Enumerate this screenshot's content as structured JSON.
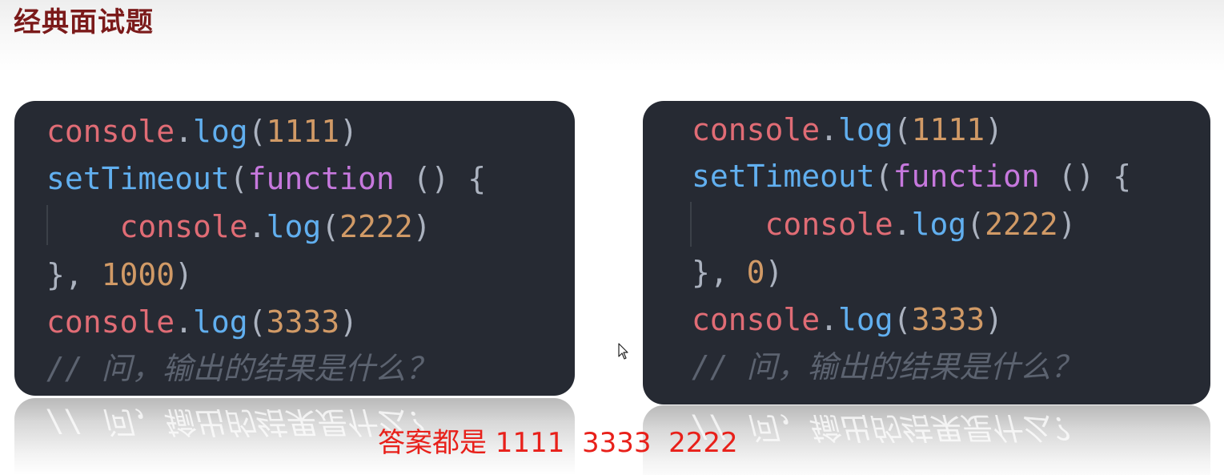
{
  "slide": {
    "title": "经典面试题"
  },
  "left_card": {
    "lines": [
      [
        {
          "t": "console",
          "k": "obj"
        },
        {
          "t": ".",
          "k": "punc"
        },
        {
          "t": "log",
          "k": "fn"
        },
        {
          "t": "(",
          "k": "punc"
        },
        {
          "t": "1111",
          "k": "num"
        },
        {
          "t": ")",
          "k": "punc"
        }
      ],
      [
        {
          "t": "setTimeout",
          "k": "fn"
        },
        {
          "t": "(",
          "k": "punc"
        },
        {
          "t": "function",
          "k": "kw"
        },
        {
          "t": " () {",
          "k": "punc"
        }
      ],
      [
        {
          "t": "    ",
          "k": "punc"
        },
        {
          "t": "console",
          "k": "obj"
        },
        {
          "t": ".",
          "k": "punc"
        },
        {
          "t": "log",
          "k": "fn"
        },
        {
          "t": "(",
          "k": "punc"
        },
        {
          "t": "2222",
          "k": "num"
        },
        {
          "t": ")",
          "k": "punc"
        }
      ],
      [
        {
          "t": "}, ",
          "k": "punc"
        },
        {
          "t": "1000",
          "k": "num"
        },
        {
          "t": ")",
          "k": "punc"
        }
      ],
      [
        {
          "t": "console",
          "k": "obj"
        },
        {
          "t": ".",
          "k": "punc"
        },
        {
          "t": "log",
          "k": "fn"
        },
        {
          "t": "(",
          "k": "punc"
        },
        {
          "t": "3333",
          "k": "num"
        },
        {
          "t": ")",
          "k": "punc"
        }
      ],
      [
        {
          "t": "// 问，输出的结果是什么？",
          "k": "comment"
        }
      ]
    ]
  },
  "right_card": {
    "lines": [
      [
        {
          "t": "console",
          "k": "obj"
        },
        {
          "t": ".",
          "k": "punc"
        },
        {
          "t": "log",
          "k": "fn"
        },
        {
          "t": "(",
          "k": "punc"
        },
        {
          "t": "1111",
          "k": "num"
        },
        {
          "t": ")",
          "k": "punc"
        }
      ],
      [
        {
          "t": "setTimeout",
          "k": "fn"
        },
        {
          "t": "(",
          "k": "punc"
        },
        {
          "t": "function",
          "k": "kw"
        },
        {
          "t": " () {",
          "k": "punc"
        }
      ],
      [
        {
          "t": "    ",
          "k": "punc"
        },
        {
          "t": "console",
          "k": "obj"
        },
        {
          "t": ".",
          "k": "punc"
        },
        {
          "t": "log",
          "k": "fn"
        },
        {
          "t": "(",
          "k": "punc"
        },
        {
          "t": "2222",
          "k": "num"
        },
        {
          "t": ")",
          "k": "punc"
        }
      ],
      [
        {
          "t": "}, ",
          "k": "punc"
        },
        {
          "t": "0",
          "k": "num"
        },
        {
          "t": ")",
          "k": "punc"
        }
      ],
      [
        {
          "t": "console",
          "k": "obj"
        },
        {
          "t": ".",
          "k": "punc"
        },
        {
          "t": "log",
          "k": "fn"
        },
        {
          "t": "(",
          "k": "punc"
        },
        {
          "t": "3333",
          "k": "num"
        },
        {
          "t": ")",
          "k": "punc"
        }
      ],
      [
        {
          "t": "// 问，输出的结果是什么？",
          "k": "comment"
        }
      ]
    ]
  },
  "answer": {
    "text": "答案都是 1111  3333  2222"
  },
  "colors": {
    "title": "#7b1a1a",
    "answer": "#e8201a",
    "card_bg": "#262a33"
  },
  "icons": {
    "cursor": "mouse-pointer-icon"
  }
}
